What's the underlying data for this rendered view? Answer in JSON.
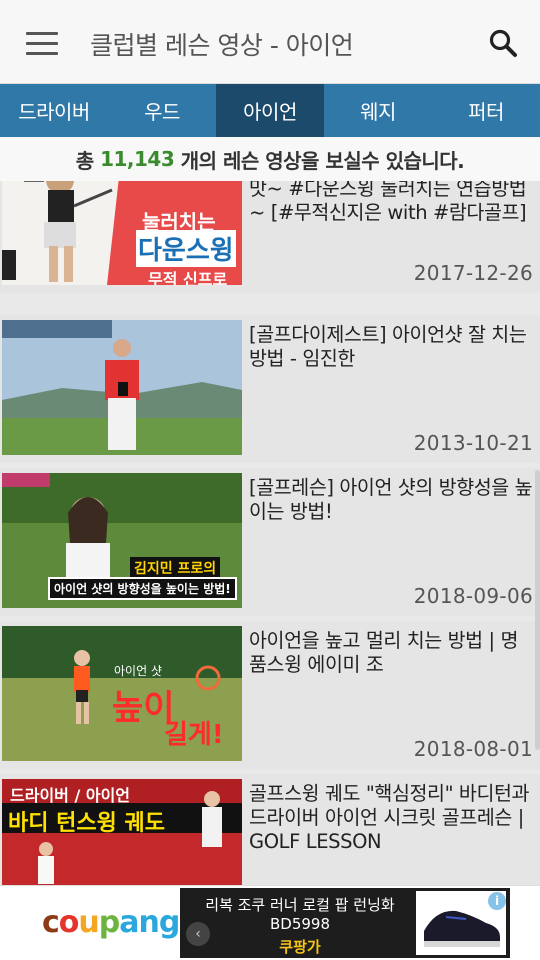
{
  "header": {
    "title": "클럽별 레슨 영상 - 아이언",
    "menu_icon": "hamburger-menu-icon",
    "search_icon": "search-icon"
  },
  "tabs": [
    {
      "label": "드라이버",
      "active": false
    },
    {
      "label": "우드",
      "active": false
    },
    {
      "label": "아이언",
      "active": true
    },
    {
      "label": "웨지",
      "active": false
    },
    {
      "label": "퍼터",
      "active": false
    }
  ],
  "count_bar": {
    "prefix": "총",
    "count": "11,143",
    "suffix": "개의 레슨 영상을 보실수 있습니다."
  },
  "videos": [
    {
      "title": "[#노잇레슨] 아이언은 눌러쳐야 제맛~ #다운스윙 눌러치는 연습방법~ [#무적신지은 with #람다골프]",
      "date": "2017-12-26",
      "thumb_caption_1": "눌러치는",
      "thumb_caption_2": "다운스윙",
      "thumb_caption_3": "무적 신프로"
    },
    {
      "title": "[골프다이제스트] 아이언샷 잘 치는 방법 - 임진한",
      "date": "2013-10-21"
    },
    {
      "title": "[골프레슨] 아이언 샷의 방향성을 높이는 방법!",
      "date": "2018-09-06",
      "thumb_caption_1": "김지민 프로의",
      "thumb_caption_2": "아이언 샷의 방향성을 높이는 방법!"
    },
    {
      "title": "아이언을 높고 멀리 치는 방법 | 명품스윙 에이미 조",
      "date": "2018-08-01",
      "thumb_caption_1": "아이언 샷",
      "thumb_caption_2": "높이",
      "thumb_caption_3": "길게!"
    },
    {
      "title": "골프스윙 궤도 \"핵심정리\" 바디턴과 드라이버 아이언 시크릿 골프레슨 | GOLF LESSON",
      "date": "",
      "thumb_caption_1": "드라이버 / 아이언",
      "thumb_caption_2": "바디 턴스윙 궤도"
    }
  ],
  "ad": {
    "logo": "coupang",
    "text": "리복 조쿠 러너 로컬 팝 런닝화 BD5998",
    "brand": "쿠팡가",
    "info_icon": "i",
    "prev_icon": "‹"
  },
  "colors": {
    "tab_bg": "#2f78a8",
    "tab_active_bg": "#1c4a6b",
    "count_green": "#3a8a2e"
  }
}
